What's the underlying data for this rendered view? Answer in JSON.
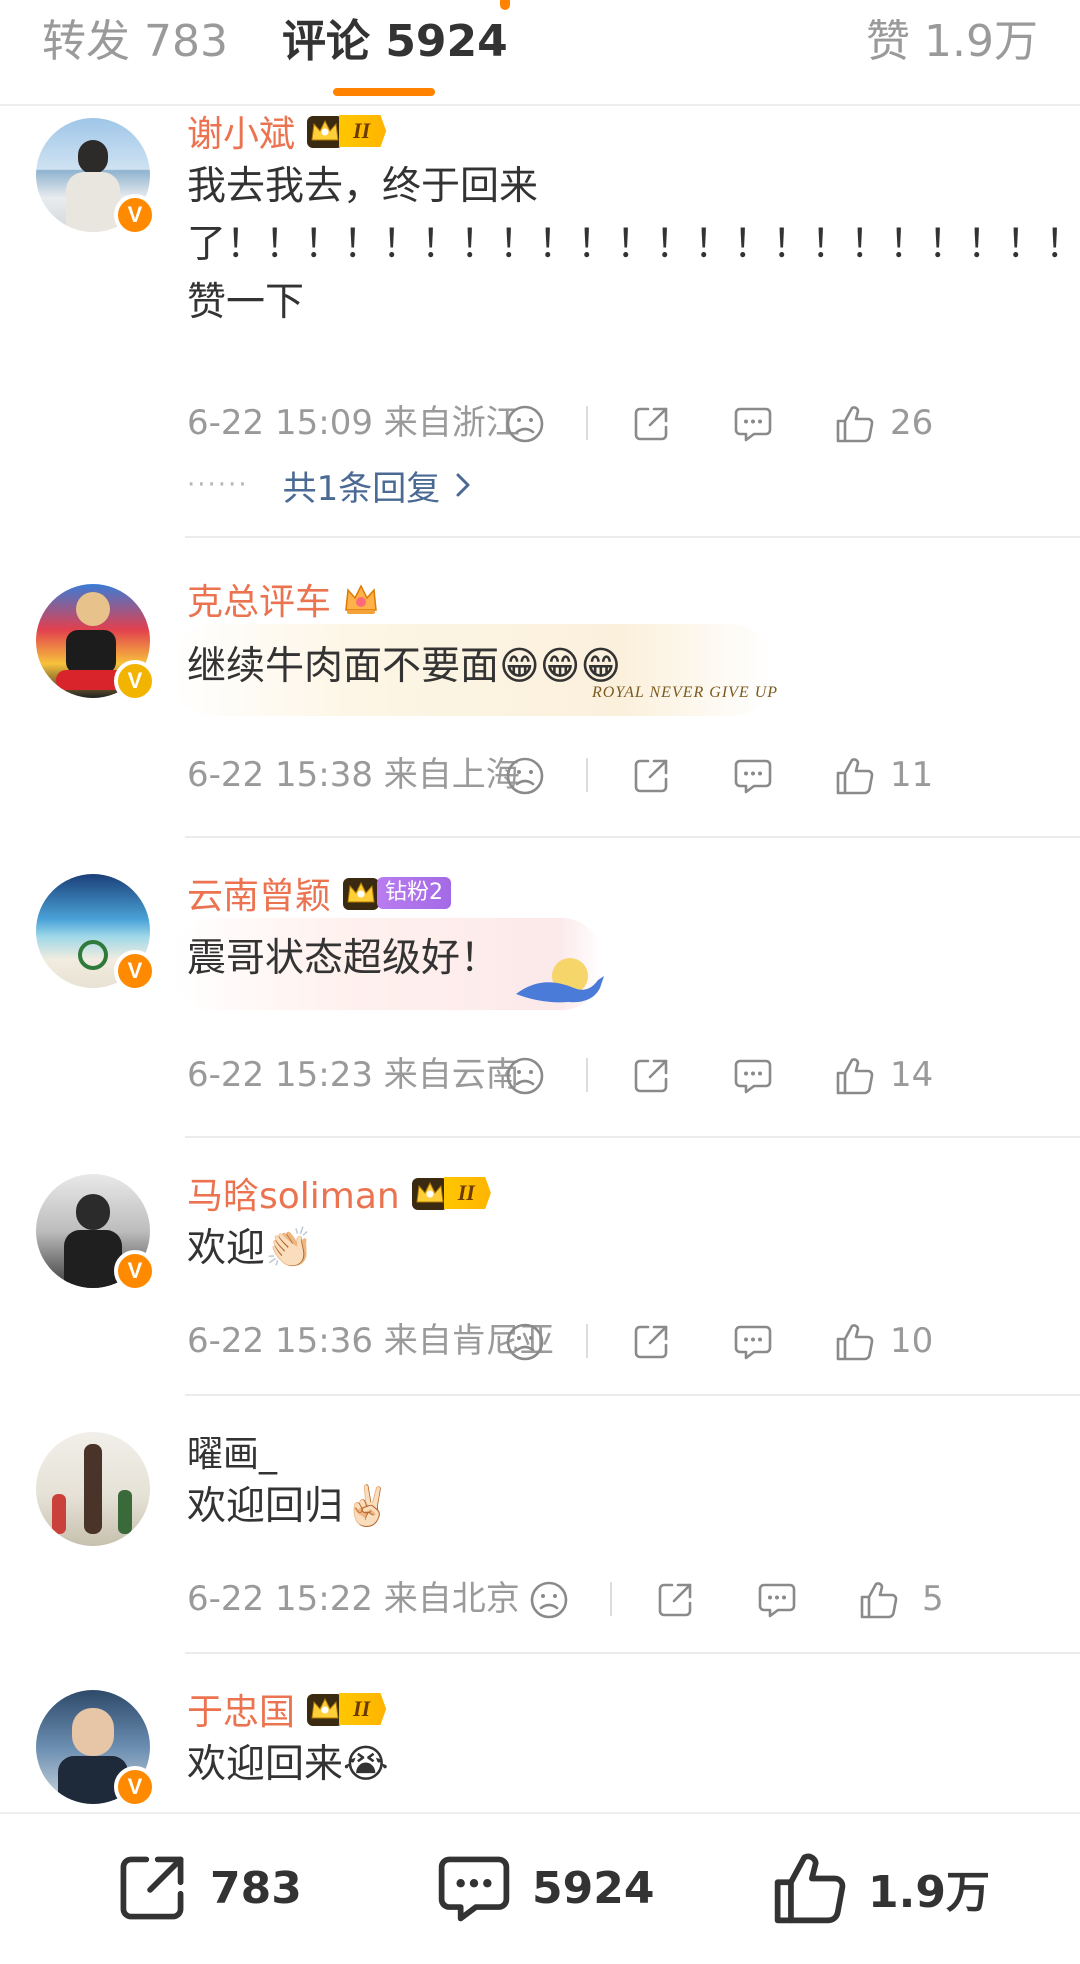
{
  "tabs": {
    "repost": "转发 783",
    "comment": "评论 5924",
    "like": "赞 1.9万"
  },
  "comments": [
    {
      "name": "谢小斌",
      "vip_level": "II",
      "text": "我去我去，终于回来了！！！！！！！！！！！！！！！！！！！！！！！！赞一下",
      "time": "6-22 15:09",
      "location": "来自浙江",
      "likes": "26",
      "replies": "共1条回复"
    },
    {
      "name": "克总评车",
      "text": "继续牛肉面不要面😁😁😁",
      "bubble_mark": "ROYAL NEVER GIVE UP",
      "time": "6-22 15:38",
      "location": "来自上海",
      "likes": "11"
    },
    {
      "name": "云南曾颖",
      "fan_badge": "钻粉2",
      "text": "震哥状态超级好！",
      "time": "6-22 15:23",
      "location": "来自云南",
      "likes": "14"
    },
    {
      "name": "马晗soliman",
      "vip_level": "II",
      "text": "欢迎👏🏻",
      "time": "6-22 15:36",
      "location": "来自肯尼亚",
      "likes": "10"
    },
    {
      "name": "曜画_",
      "text": "欢迎回归✌🏻",
      "time": "6-22 15:22",
      "location": "来自北京",
      "likes": "5"
    },
    {
      "name": "于忠国",
      "vip_level": "II",
      "text": "欢迎回来😭"
    }
  ],
  "bottom_bar": {
    "repost_count": "783",
    "comment_count": "5924",
    "like_count": "1.9万"
  },
  "icons": {
    "sad": "sad-face-icon",
    "share": "share-icon",
    "comment": "comment-icon",
    "like": "thumbs-up-icon",
    "verified": "verified-v-icon",
    "chevron": "chevron-right-icon"
  },
  "colors": {
    "accent": "#ff8200",
    "username": "#eb7350",
    "meta": "#9a9a9a",
    "reply_link": "#4a6a93",
    "vip_gold": "#ffc700",
    "fan_purple": "#a46ae6"
  }
}
